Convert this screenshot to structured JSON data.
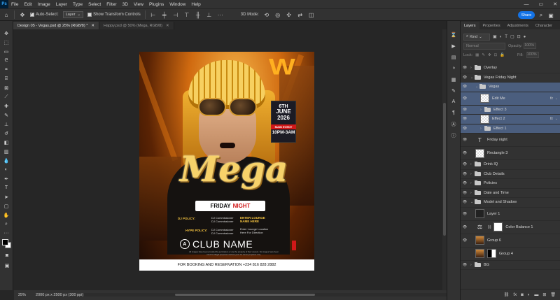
{
  "menu": {
    "logo": "Ps",
    "items": [
      "File",
      "Edit",
      "Image",
      "Layer",
      "Type",
      "Select",
      "Filter",
      "3D",
      "View",
      "Plugins",
      "Window",
      "Help"
    ],
    "window_controls": [
      "—",
      "▭",
      "✕"
    ]
  },
  "options": {
    "auto_select_label": "Auto-Select:",
    "auto_select_value": "Layer",
    "transform_label": "Show Transform Controls",
    "mode_3d_label": "3D Mode:",
    "share_label": "Share"
  },
  "tabs": [
    {
      "label": "Design 05 - Vegas.psd @ 25% (RGB/8) *",
      "active": true
    },
    {
      "label": "Happy.psd @ 50% (Mega, RGB/8)",
      "active": false
    }
  ],
  "poster": {
    "date_line1": "6TH",
    "date_line2": "JUNE",
    "date_line3": "2026",
    "main_event": "MAIN EVENT",
    "time": "10PM-3AM",
    "mega": "Mega",
    "friday": "FRIDAY",
    "night": "NIGHT",
    "dj_label": "DJ POLICY:",
    "dj_lines": [
      "DJ Commissioner",
      "DJ Commissioner"
    ],
    "enter_label": "ENTER LOUNGE NAME HERE",
    "hype_label": "HYPE POLICY:",
    "hype_lines": [
      "DJ Commissioner",
      "DJ Commissioner"
    ],
    "location_lines": [
      "Enter Lounge Location",
      "Here For Direction"
    ],
    "club_name": "CLUB NAME",
    "club_icon": "A",
    "fine_print": "All images have been provided by permission or are the property of their owners. No images have been used for illegal purposes and are pure for demo purposes only.",
    "footer": "FOR BOOKING AND RESERVATION +234 816 828 2882"
  },
  "status": {
    "zoom": "25%",
    "doc_size": "2000 px x 2500 px (300 ppi)"
  },
  "panel": {
    "tabs": [
      "Layers",
      "Properties",
      "Adjustments",
      "Character"
    ],
    "kind_label": "Kind",
    "blend_mode": "Normal",
    "opacity_label": "Opacity:",
    "opacity_value": "100%",
    "lock_label": "Lock:",
    "fill_label": "Fill:",
    "fill_value": "100%",
    "layers": [
      {
        "name": "Overlay",
        "type": "folder",
        "indent": 0,
        "visible": true,
        "selected": false,
        "fx": false
      },
      {
        "name": "Vegas Friday Night",
        "type": "folder-open",
        "indent": 0,
        "visible": true,
        "selected": false,
        "fx": false
      },
      {
        "name": "Vegas",
        "type": "folder-open",
        "indent": 1,
        "visible": true,
        "selected": true,
        "fx": false
      },
      {
        "name": "Edit Me",
        "type": "checker",
        "indent": 2,
        "visible": true,
        "selected": true,
        "fx": true,
        "tall": true
      },
      {
        "name": "Effect 3",
        "type": "folder",
        "indent": 2,
        "visible": true,
        "selected": true,
        "fx": false
      },
      {
        "name": "Effect 2",
        "type": "checker",
        "indent": 2,
        "visible": true,
        "selected": true,
        "fx": true
      },
      {
        "name": "Effect 1",
        "type": "folder",
        "indent": 2,
        "visible": true,
        "selected": true,
        "fx": false
      },
      {
        "name": "Friday night",
        "type": "text",
        "indent": 1,
        "visible": true,
        "selected": false,
        "fx": false,
        "tall": true
      },
      {
        "name": "Rectangle 3",
        "type": "checker",
        "indent": 1,
        "visible": true,
        "selected": false,
        "fx": false,
        "tall": true
      },
      {
        "name": "Drink IQ",
        "type": "folder",
        "indent": 0,
        "visible": true,
        "selected": false,
        "fx": false
      },
      {
        "name": "Club Details",
        "type": "folder",
        "indent": 0,
        "visible": true,
        "selected": false,
        "fx": false
      },
      {
        "name": "Policies",
        "type": "folder",
        "indent": 0,
        "visible": true,
        "selected": false,
        "fx": false
      },
      {
        "name": "Date and Time",
        "type": "folder",
        "indent": 0,
        "visible": true,
        "selected": false,
        "fx": false
      },
      {
        "name": "Model and Shadow",
        "type": "folder-open",
        "indent": 0,
        "visible": true,
        "selected": false,
        "fx": false
      },
      {
        "name": "Layer 1",
        "type": "dark",
        "indent": 1,
        "visible": true,
        "selected": false,
        "fx": false,
        "tall": true
      },
      {
        "name": "Color Balance 1",
        "type": "adjust",
        "indent": 1,
        "visible": true,
        "selected": false,
        "fx": false,
        "tall": true
      },
      {
        "name": "Group 6",
        "type": "photo",
        "indent": 1,
        "visible": true,
        "selected": false,
        "fx": false,
        "tall": true
      },
      {
        "name": "Group 4",
        "type": "photo-mask",
        "indent": 1,
        "visible": false,
        "selected": false,
        "fx": false,
        "tall": true
      },
      {
        "name": "BG",
        "type": "folder",
        "indent": 0,
        "visible": true,
        "selected": false,
        "fx": false
      }
    ]
  }
}
